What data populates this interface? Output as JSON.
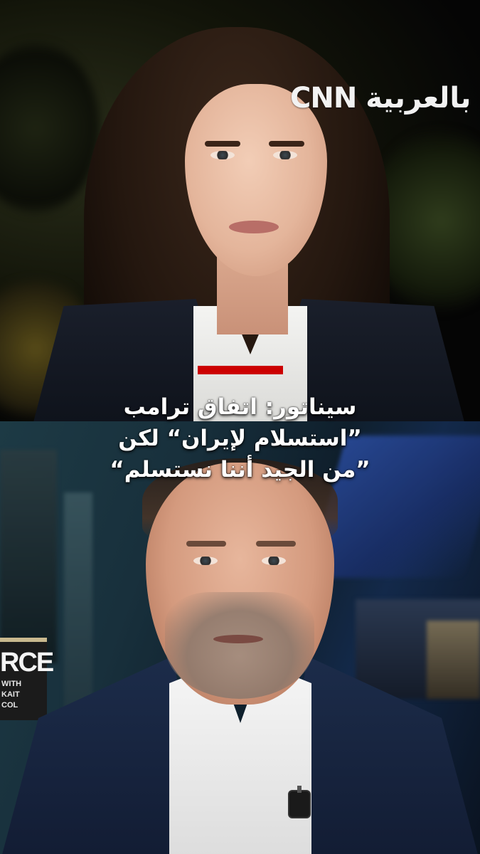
{
  "brand": {
    "channel_logo": "CNN بالعربية",
    "accent_color": "#cc0000"
  },
  "headline": {
    "lines": [
      "سيناتور: اتفاق ترامب",
      "”استسلام لإيران“ لكن",
      "”من الجيد أننا نستسلم“"
    ]
  },
  "show_logo": {
    "main": "RCE",
    "line1": "WITH",
    "line2": "KAIT",
    "line3": "COL"
  }
}
